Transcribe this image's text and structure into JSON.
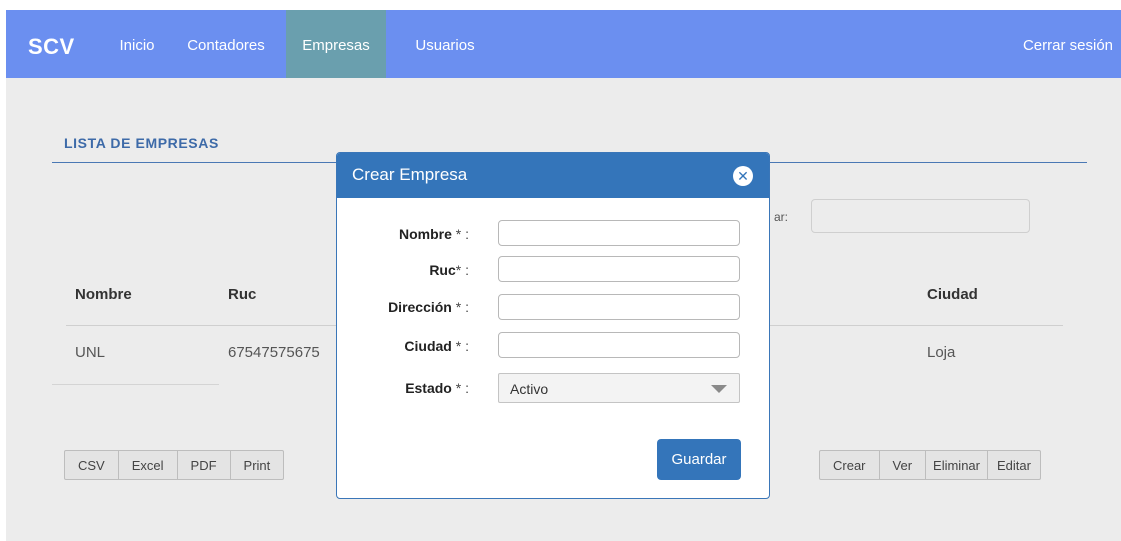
{
  "navbar": {
    "brand": "SCV",
    "links": [
      {
        "label": "Inicio"
      },
      {
        "label": "Contadores"
      },
      {
        "label": "Empresas"
      },
      {
        "label": "Usuarios"
      }
    ],
    "logout_label": "Cerrar sesión",
    "active_tab": "Empresas",
    "color": "#6b8ff0"
  },
  "page": {
    "section_title": "LISTA DE EMPRESAS",
    "search_label_partial": "ar:",
    "search_value": "",
    "table": {
      "columns": [
        "Nombre",
        "Ruc",
        "Ciudad"
      ],
      "rows": [
        {
          "nombre": "UNL",
          "ruc": "67547575675",
          "ciudad": "Loja"
        }
      ]
    },
    "export_buttons": [
      "CSV",
      "Excel",
      "PDF",
      "Print"
    ],
    "action_buttons": [
      "Crear",
      "Ver",
      "Eliminar",
      "Editar"
    ]
  },
  "modal": {
    "title": "Crear Empresa",
    "fields": [
      {
        "label": "Nombre",
        "suffix": " * :",
        "value": ""
      },
      {
        "label": "Ruc",
        "suffix": "* :",
        "value": ""
      },
      {
        "label": "Dirección",
        "suffix": " * :",
        "value": ""
      },
      {
        "label": "Ciudad",
        "suffix": " * :",
        "value": ""
      }
    ],
    "estado": {
      "label": "Estado",
      "suffix": " * :",
      "selected": "Activo"
    },
    "save_label": "Guardar",
    "header_color": "#3475ba"
  }
}
